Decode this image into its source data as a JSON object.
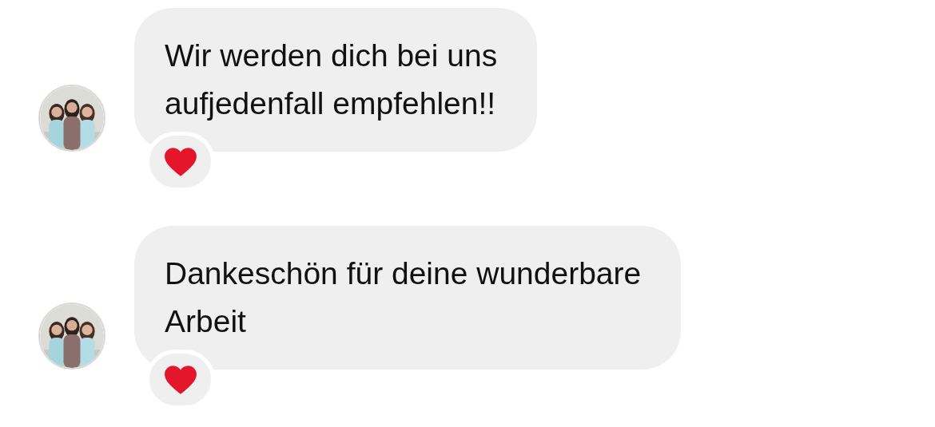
{
  "messages": [
    {
      "lines": [
        "Wir werden dich bei uns",
        "aufjedenfall empfehlen!!"
      ],
      "reaction": {
        "kind": "heart"
      }
    },
    {
      "lines": [
        "Dankeschön für deine wunderbare",
        "Arbeit"
      ],
      "reaction": {
        "kind": "heart"
      }
    }
  ]
}
